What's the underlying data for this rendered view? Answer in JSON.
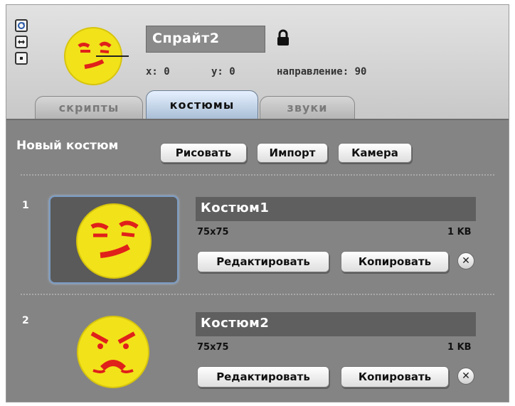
{
  "sprite": {
    "name": "Спрайт2",
    "x_label": "x: 0",
    "y_label": "y: 0",
    "direction_label": "направление: 90"
  },
  "tabs": [
    {
      "label": "скрипты"
    },
    {
      "label": "костюмы",
      "active": true
    },
    {
      "label": "звуки"
    }
  ],
  "costumes_panel": {
    "new_costume_label": "Новый костюм",
    "paint_button": "Рисовать",
    "import_button": "Импорт",
    "camera_button": "Камера"
  },
  "costumes": [
    {
      "index": "1",
      "name": "Костюм1",
      "size": "75x75",
      "filesize": "1 KB",
      "edit_button": "Редактировать",
      "copy_button": "Копировать",
      "selected": true
    },
    {
      "index": "2",
      "name": "Костюм2",
      "size": "75x75",
      "filesize": "1 KB",
      "edit_button": "Редактировать",
      "copy_button": "Копировать",
      "selected": false
    }
  ],
  "icons": {
    "rotate": "rotate-icon",
    "flip": "flip-icon",
    "no_rotate": "no-rotate-icon",
    "lock": "lock-icon",
    "delete": "delete-icon"
  },
  "colors": {
    "header_bg": "#d8d8d8",
    "panel_bg": "#848484",
    "face_yellow": "#f2e21a",
    "face_red": "#e0201a",
    "active_tab": "#b9cde3"
  }
}
